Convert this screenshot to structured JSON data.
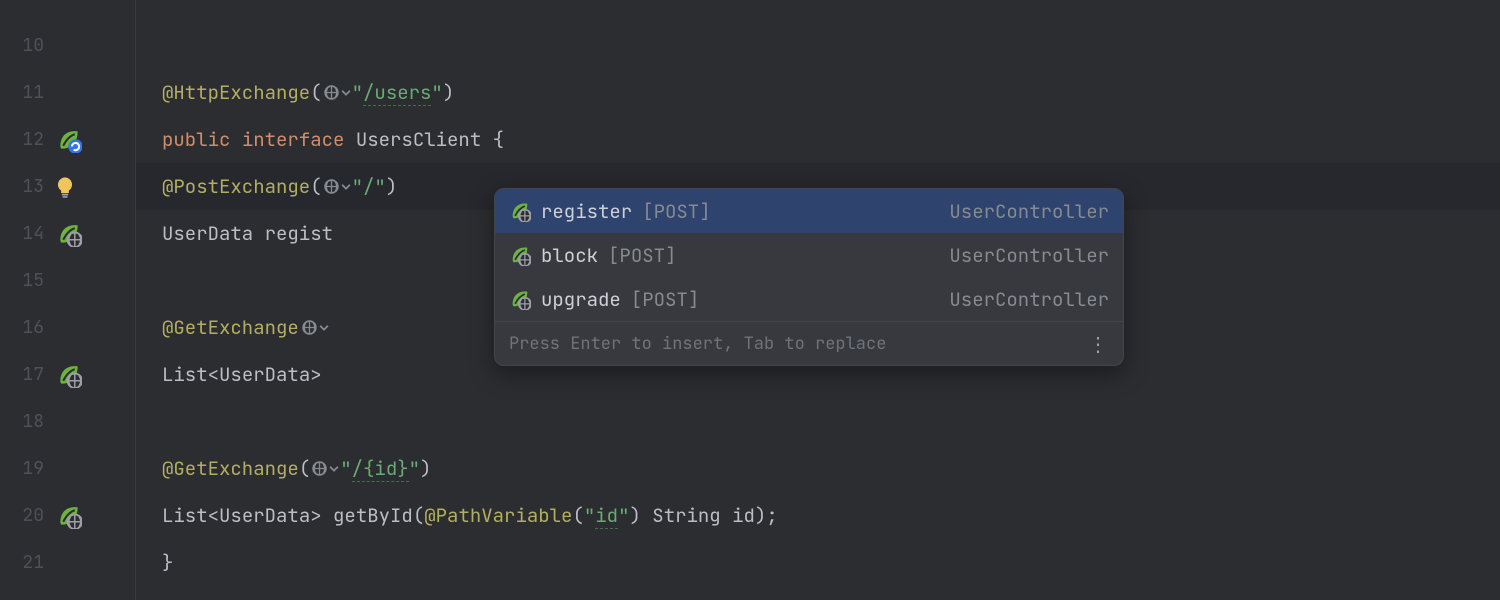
{
  "gutter": {
    "start": 10,
    "end": 21
  },
  "code": {
    "l11": {
      "anno": "@HttpExchange",
      "path": "/users"
    },
    "l12": {
      "kw_public": "public",
      "kw_interface": "interface",
      "name": "UsersClient"
    },
    "l13": {
      "anno": "@PostExchange",
      "str": "/"
    },
    "l14": {
      "type": "UserData",
      "method_partial": "regist"
    },
    "l16": {
      "anno": "@GetExchange"
    },
    "l17": {
      "type": "List",
      "generic": "UserData"
    },
    "l19": {
      "anno": "@GetExchange",
      "path": "/{id}"
    },
    "l20": {
      "type": "List",
      "generic": "UserData",
      "method": "getById",
      "param_anno": "@PathVariable",
      "param_str": "id",
      "param_type": "String",
      "param_name": "id"
    }
  },
  "popup": {
    "items": [
      {
        "name": "register",
        "http": "[POST]",
        "owner": "UserController"
      },
      {
        "name": "block",
        "http": "[POST]",
        "owner": "UserController"
      },
      {
        "name": "upgrade",
        "http": "[POST]",
        "owner": "UserController"
      }
    ],
    "hint": "Press Enter to insert, Tab to replace"
  },
  "icons": {
    "bulb": "bulb-icon",
    "globe": "globe-icon",
    "leaf_globe": "spring-web-icon",
    "leaf_client": "spring-client-icon",
    "chevron": "chevron-down-icon",
    "more": "⋮"
  }
}
